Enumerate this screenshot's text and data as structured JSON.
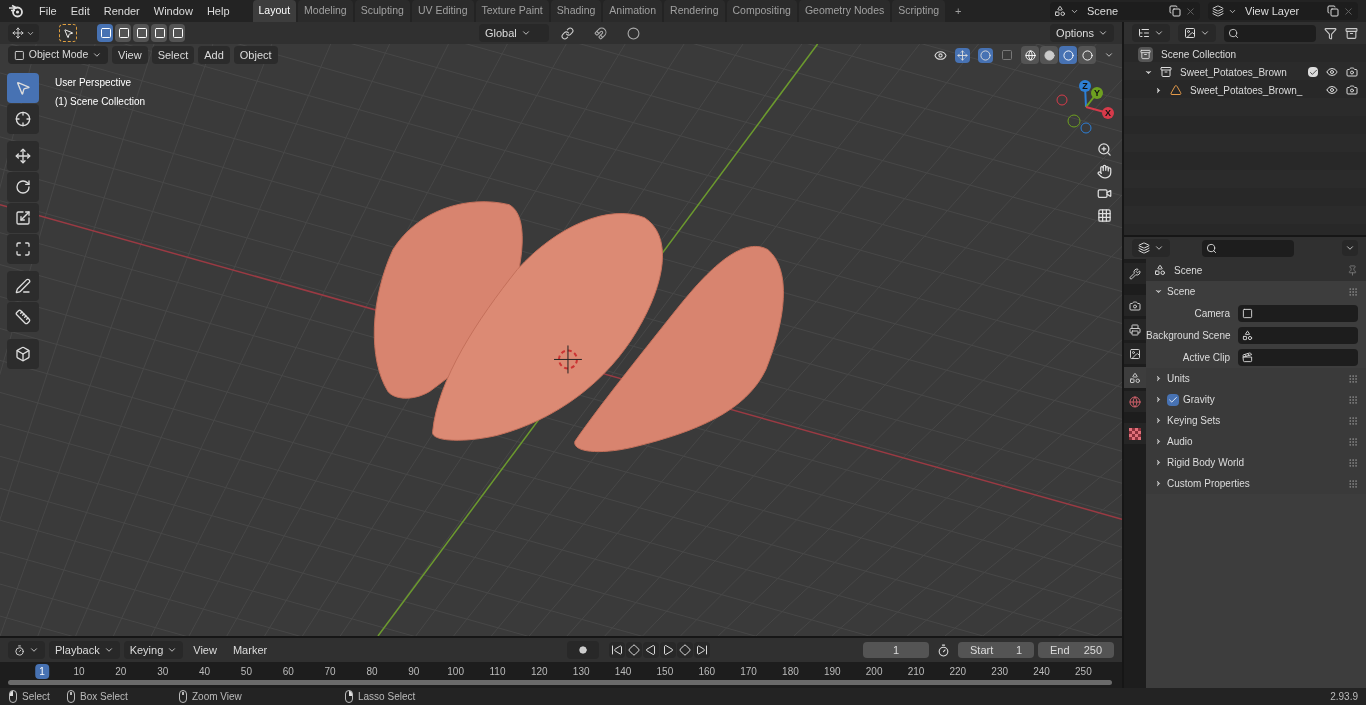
{
  "top_bar": {
    "menus": [
      "File",
      "Edit",
      "Render",
      "Window",
      "Help"
    ],
    "workspaces": [
      {
        "label": "Layout",
        "selected": true
      },
      {
        "label": "Modeling",
        "selected": false
      },
      {
        "label": "Sculpting",
        "selected": false
      },
      {
        "label": "UV Editing",
        "selected": false
      },
      {
        "label": "Texture Paint",
        "selected": false
      },
      {
        "label": "Shading",
        "selected": false
      },
      {
        "label": "Animation",
        "selected": false
      },
      {
        "label": "Rendering",
        "selected": false
      },
      {
        "label": "Compositing",
        "selected": false
      },
      {
        "label": "Geometry Nodes",
        "selected": false
      },
      {
        "label": "Scripting",
        "selected": false
      }
    ],
    "add_workspace": "+",
    "scene": "Scene",
    "view_layer": "View Layer"
  },
  "viewport": {
    "mode": "Object Mode",
    "menus": [
      "View",
      "Select",
      "Add",
      "Object"
    ],
    "orientation": "Global",
    "options": "Options",
    "info": [
      "User Perspective",
      "(1) Scene Collection"
    ],
    "tools": [
      {
        "kind": "select",
        "selected": true
      },
      {
        "kind": "cursor",
        "selected": false
      },
      {
        "kind": "move",
        "selected": false
      },
      {
        "kind": "rotate",
        "selected": false
      },
      {
        "kind": "scale",
        "selected": false
      },
      {
        "kind": "transform",
        "selected": false
      },
      {
        "kind": "annotate",
        "selected": false
      },
      {
        "kind": "measure",
        "selected": false
      },
      {
        "kind": "add_cube",
        "selected": false
      }
    ],
    "gizmo_axes": [
      "Z",
      "Y",
      "X"
    ],
    "shading": [
      {
        "kind": "wireframe",
        "selected": false
      },
      {
        "kind": "solid",
        "selected": false
      },
      {
        "kind": "material",
        "selected": true
      },
      {
        "kind": "rendered",
        "selected": false
      }
    ]
  },
  "outliner": {
    "items": [
      {
        "label": "Scene Collection",
        "kind": "scene",
        "children": [
          {
            "label": "Sweet_Potatoes_Brown",
            "kind": "collection",
            "expanded": true,
            "checked": true,
            "children": [
              {
                "label": "Sweet_Potatoes_Brown_",
                "kind": "object",
                "expanded": false
              }
            ]
          }
        ]
      }
    ]
  },
  "properties": {
    "tabs": [
      {
        "kind": "tool",
        "selected": false
      },
      {
        "kind": "render",
        "selected": false
      },
      {
        "kind": "output",
        "selected": false
      },
      {
        "kind": "view_layer",
        "selected": false
      },
      {
        "kind": "scene",
        "selected": true
      },
      {
        "kind": "world",
        "selected": false
      },
      {
        "kind": "texture",
        "selected": false
      }
    ],
    "context": "Scene",
    "panels": [
      {
        "title": "Scene",
        "expanded": true,
        "fields": [
          {
            "label": "Camera",
            "kind": "camera"
          },
          {
            "label": "Background Scene",
            "kind": "scene"
          },
          {
            "label": "Active Clip",
            "kind": "clip"
          }
        ]
      },
      {
        "title": "Units",
        "expanded": false
      },
      {
        "title": "Gravity",
        "expanded": false,
        "checked": true
      },
      {
        "title": "Keying Sets",
        "expanded": false
      },
      {
        "title": "Audio",
        "expanded": false
      },
      {
        "title": "Rigid Body World",
        "expanded": false
      },
      {
        "title": "Custom Properties",
        "expanded": false
      }
    ]
  },
  "timeline": {
    "menus": [
      "Playback",
      "Keying",
      "View",
      "Marker"
    ],
    "current_frame": "1",
    "start_label": "Start",
    "start": "1",
    "end_label": "End",
    "end": "250",
    "ticks": [
      {
        "label": "1",
        "selected": true
      },
      {
        "label": "10",
        "selected": false
      },
      {
        "label": "20",
        "selected": false
      },
      {
        "label": "30",
        "selected": false
      },
      {
        "label": "40",
        "selected": false
      },
      {
        "label": "50",
        "selected": false
      },
      {
        "label": "60",
        "selected": false
      },
      {
        "label": "70",
        "selected": false
      },
      {
        "label": "80",
        "selected": false
      },
      {
        "label": "90",
        "selected": false
      },
      {
        "label": "100",
        "selected": false
      },
      {
        "label": "110",
        "selected": false
      },
      {
        "label": "120",
        "selected": false
      },
      {
        "label": "130",
        "selected": false
      },
      {
        "label": "140",
        "selected": false
      },
      {
        "label": "150",
        "selected": false
      },
      {
        "label": "160",
        "selected": false
      },
      {
        "label": "170",
        "selected": false
      },
      {
        "label": "180",
        "selected": false
      },
      {
        "label": "190",
        "selected": false
      },
      {
        "label": "200",
        "selected": false
      },
      {
        "label": "210",
        "selected": false
      },
      {
        "label": "220",
        "selected": false
      },
      {
        "label": "230",
        "selected": false
      },
      {
        "label": "240",
        "selected": false
      },
      {
        "label": "250",
        "selected": false
      }
    ]
  },
  "status_bar": {
    "hints": [
      {
        "kind": "left",
        "label": "Select"
      },
      {
        "kind": "middle",
        "label": "Box Select"
      },
      {
        "kind": "middle",
        "label": "Zoom View"
      },
      {
        "kind": "right",
        "label": "Lasso Select"
      }
    ],
    "version": "2.93.9"
  }
}
